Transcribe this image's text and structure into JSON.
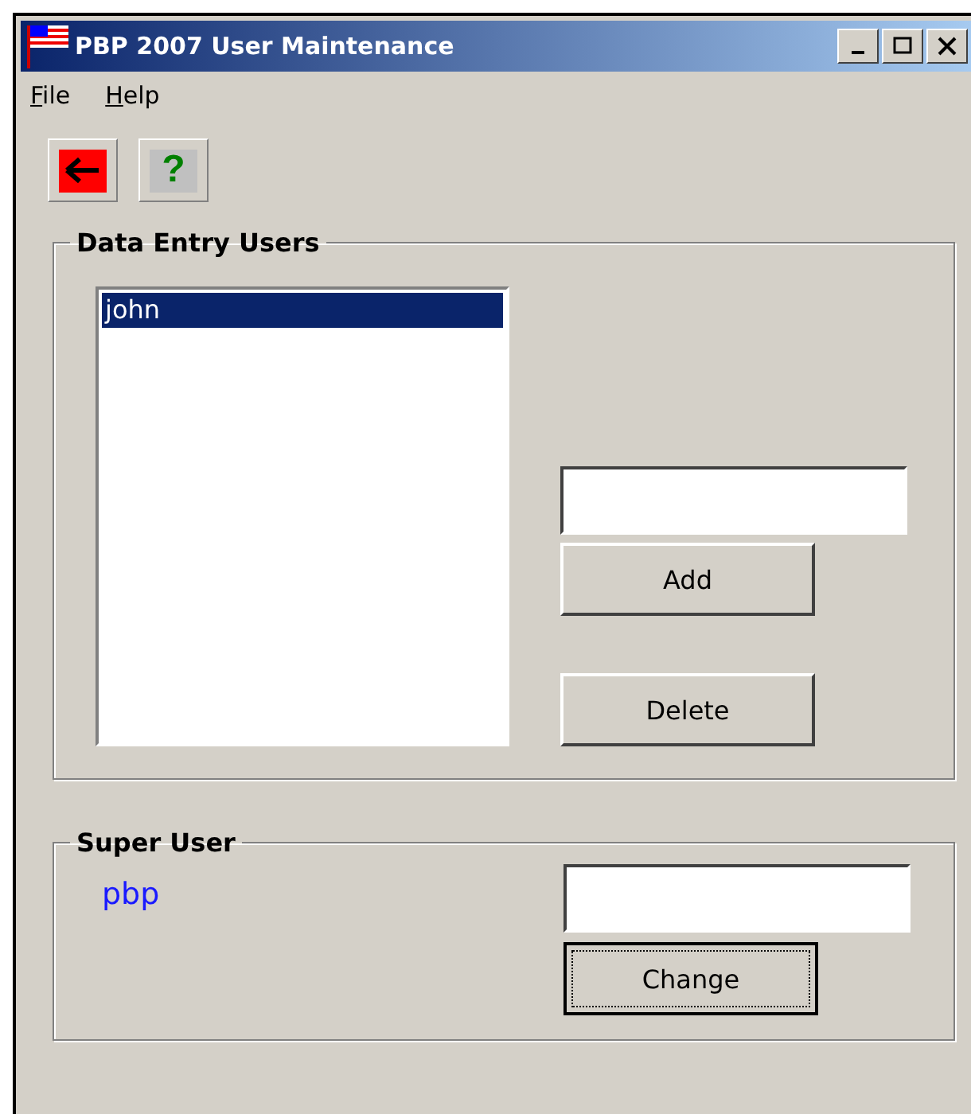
{
  "window": {
    "title": "PBP 2007 User Maintenance"
  },
  "menu": [
    {
      "label": "File"
    },
    {
      "label": "Help"
    }
  ],
  "toolbar": [
    {
      "kind": "back"
    },
    {
      "kind": "help",
      "label": "?"
    }
  ],
  "data_entry_users": {
    "title": "Data Entry Users",
    "users": [
      {
        "name": "john",
        "selected": true
      }
    ],
    "buttons": [
      {
        "label": "Add",
        "focused": false
      },
      {
        "label": "Delete",
        "focused": false
      }
    ]
  },
  "super_user": {
    "title": "Super User",
    "name": "pbp",
    "button": {
      "label": "Change",
      "focused": true
    }
  }
}
